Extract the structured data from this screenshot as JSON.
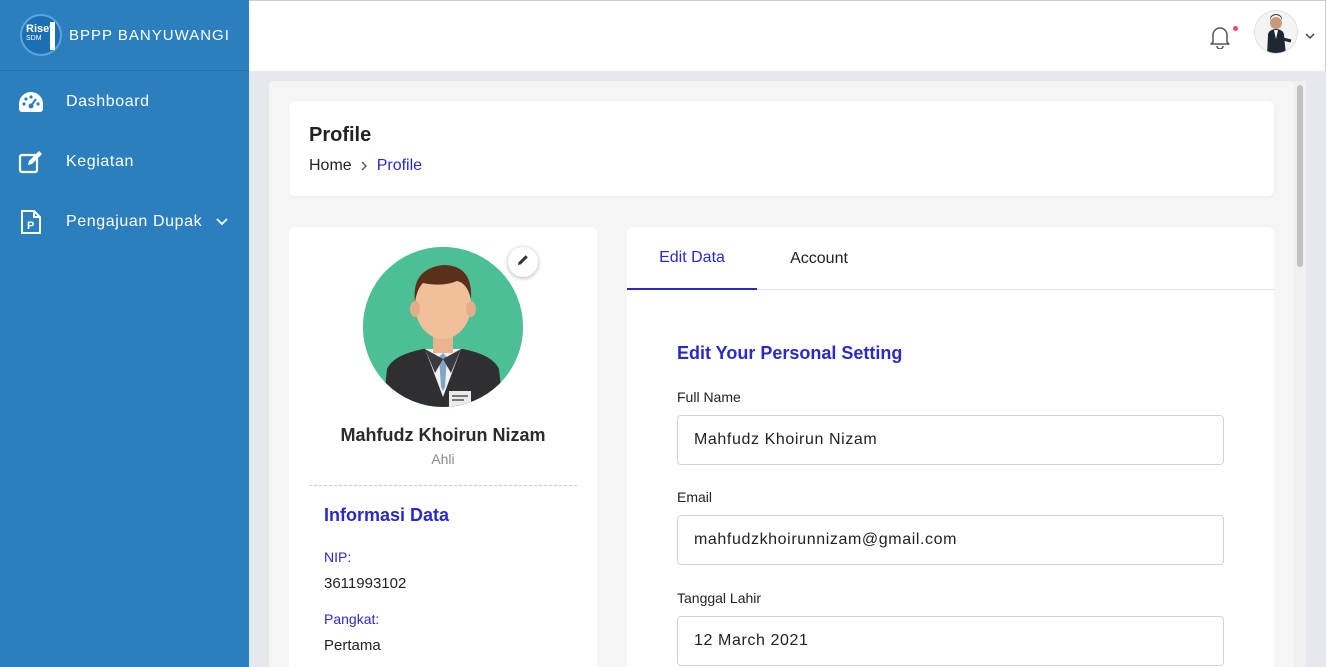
{
  "brand": {
    "name": "BPPP BANYUWANGI",
    "logo_text_top": "Riset",
    "logo_text_bottom": "SDM"
  },
  "sidebar": {
    "items": [
      {
        "label": "Dashboard",
        "icon": "dashboard-gauge-icon"
      },
      {
        "label": "Kegiatan",
        "icon": "edit-square-icon"
      },
      {
        "label": "Pengajuan Dupak",
        "icon": "document-p-icon",
        "has_submenu": true
      }
    ]
  },
  "topbar": {
    "notification_icon": "bell-icon",
    "has_unread": true,
    "avatar": "user-avatar"
  },
  "header": {
    "title": "Profile",
    "breadcrumb": {
      "home": "Home",
      "current": "Profile"
    }
  },
  "profile": {
    "name": "Mahfudz Khoirun Nizam",
    "role": "Ahli",
    "info_title": "Informasi Data",
    "fields": [
      {
        "label": "NIP:",
        "value": "3611993102"
      },
      {
        "label": "Pangkat:",
        "value": "Pertama"
      }
    ]
  },
  "tabs": [
    {
      "label": "Edit Data",
      "active": true
    },
    {
      "label": "Account",
      "active": false
    }
  ],
  "form": {
    "title": "Edit Your Personal Setting",
    "full_name_label": "Full Name",
    "full_name_value": "Mahfudz Khoirun Nizam",
    "email_label": "Email",
    "email_value": "mahfudzkhoirunnizam@gmail.com",
    "dob_label": "Tanggal Lahir",
    "dob_value": "12 March 2021"
  },
  "colors": {
    "sidebar": "#2b7fbf",
    "accent": "#2a2ac9",
    "avatar_bg": "#4dbf94"
  }
}
